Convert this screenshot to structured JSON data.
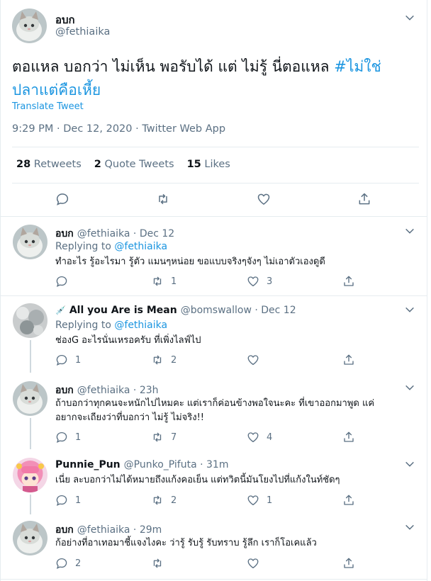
{
  "main_tweet": {
    "name": "อบก",
    "handle": "@fethiaika",
    "text_main": "ตอแหล บอกว่า ไม่เห็น พอรับได้ แต่ ไม่รู้ นี่ตอแหล ",
    "hashtag_1": "#ไม่ใช่",
    "hashtag_2": "ปลาแต่คือเหี้ย",
    "translate": "Translate Tweet",
    "meta": "9:29 PM · Dec 12, 2020 · Twitter Web App",
    "retweets_count": "28",
    "retweets_label": "Retweets",
    "quote_count": "2",
    "quote_label": "Quote Tweets",
    "likes_count": "15",
    "likes_label": "Likes"
  },
  "replying_label": "Replying to",
  "replies": [
    {
      "name": "อบก",
      "handle": "@fethiaika · Dec 12",
      "replying_to": "@fethiaika",
      "text": "ทำอะไร รู้อะไรมา รู้ตัว แมนๆหน่อย ขอแบบจริงๆจังๆ ไม่เอาตัวเองดูดี",
      "reply_count": "",
      "retweet_count": "1",
      "like_count": "3"
    },
    {
      "name": "All you Are is Mean",
      "name_emoji": "💉",
      "handle": "@bomswallow · Dec 12",
      "replying_to": "@fethiaika",
      "text": "ช่องG อะไรนั่นเหรอครับ ที่เพิ่งไลฟ์ไป",
      "reply_count": "1",
      "retweet_count": "2",
      "like_count": ""
    },
    {
      "name": "อบก",
      "handle": "@fethiaika · 23h",
      "text_line1": "ถ้าบอกว่าทุกคนจะหนักไปไหมคะ แต่เราก็ค่อนข้างพอใจนะคะ ที่เขาออกมาพูด แค่",
      "text_line2": "อยากจะเถียงว่าที่บอกว่า ไม่รู้ ไม่จริง!!",
      "reply_count": "1",
      "retweet_count": "7",
      "like_count": "4"
    },
    {
      "name": "Punnie_Pun",
      "handle": "@Punko_Pifuta · 31m",
      "text": "เนี่ย ละบอกว่าไม่ได้หมายถึงแก้งคอเย็น แต่ทวิตนี้มันโยงไปที่แก้งในท์ชัดๆ",
      "reply_count": "1",
      "retweet_count": "2",
      "like_count": "1"
    },
    {
      "name": "อบก",
      "handle": "@fethiaika · 29m",
      "text": "ก้อย่างที่อาเทอมาชี้แจงไงคะ ว่ารู้ รับรู้ รับทราบ รู้ลึก เราก็โอเคแล้ว",
      "reply_count": "2",
      "retweet_count": "",
      "like_count": ""
    }
  ],
  "colors": {
    "accent": "#1da1f2",
    "link": "#1b95e0",
    "secondary_text": "#5b7083",
    "divider": "#e6ecf0"
  },
  "icons": [
    "chevron-down-icon",
    "reply-icon",
    "retweet-icon",
    "like-icon",
    "share-icon"
  ]
}
